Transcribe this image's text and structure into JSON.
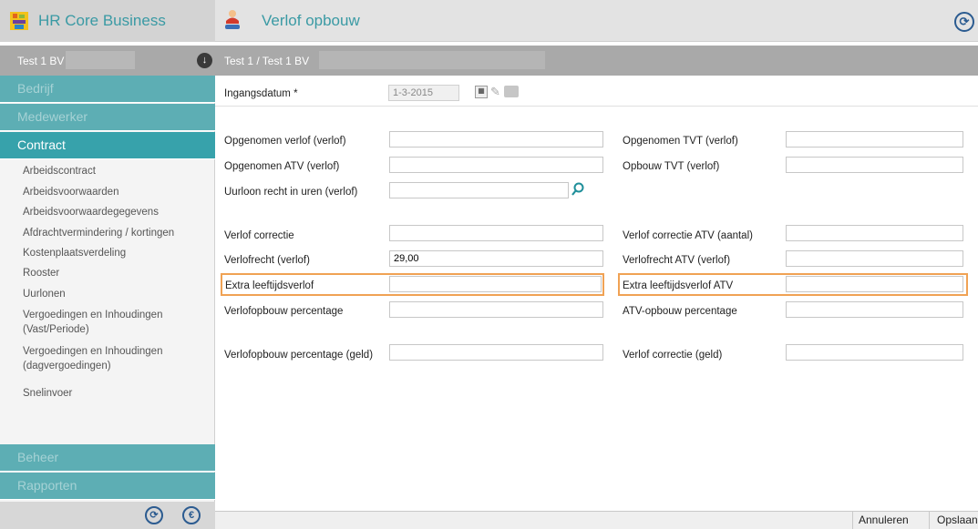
{
  "app": {
    "title": "HR Core Business",
    "logo_icon": "app-logo-icon"
  },
  "page": {
    "title": "Verlof opbouw"
  },
  "company": {
    "name": "Test 1 BV"
  },
  "breadcrumb": "Test 1 / Test 1 BV",
  "sidebar": {
    "sections": {
      "bedrijf": "Bedrijf",
      "medewerker": "Medewerker",
      "contract": "Contract",
      "beheer": "Beheer",
      "rapporten": "Rapporten"
    },
    "contract_items": [
      "Arbeidscontract",
      "Arbeidsvoorwaarden",
      "Arbeidsvoorwaardegegevens",
      "Afdrachtvermindering / kortingen",
      "Kostenplaatsverdeling",
      "Rooster",
      "Uurlonen",
      "Vergoedingen en Inhoudingen (Vast/Periode)",
      "Vergoedingen en Inhoudingen (dagvergoedingen)",
      "Snelinvoer"
    ]
  },
  "form": {
    "ingangsdatum": {
      "label": "Ingangsdatum *",
      "value": "1-3-2015"
    },
    "left": {
      "opgenomen_verlof": {
        "label": "Opgenomen verlof (verlof)",
        "value": ""
      },
      "opgenomen_atv": {
        "label": "Opgenomen ATV (verlof)",
        "value": ""
      },
      "uurloon_recht": {
        "label": "Uurloon recht in uren (verlof)",
        "value": ""
      },
      "verlof_correctie": {
        "label": "Verlof correctie",
        "value": ""
      },
      "verlofrecht": {
        "label": "Verlofrecht (verlof)",
        "value": "29,00"
      },
      "extra_leeftijdsverlof": {
        "label": "Extra leeftijdsverlof",
        "value": ""
      },
      "verlofopbouw_percentage": {
        "label": "Verlofopbouw percentage",
        "value": ""
      },
      "verlofopbouw_percentage_geld": {
        "label": "Verlofopbouw percentage (geld)",
        "value": ""
      }
    },
    "right": {
      "opgenomen_tvt": {
        "label": "Opgenomen TVT (verlof)",
        "value": ""
      },
      "opbouw_tvt": {
        "label": "Opbouw TVT (verlof)",
        "value": ""
      },
      "verlof_correctie_atv": {
        "label": "Verlof correctie ATV (aantal)",
        "value": ""
      },
      "verlofrecht_atv": {
        "label": "Verlofrecht ATV (verlof)",
        "value": ""
      },
      "extra_leeftijdsverlof_atv": {
        "label": "Extra leeftijdsverlof ATV",
        "value": ""
      },
      "atv_opbouw_percentage": {
        "label": "ATV-opbouw percentage",
        "value": ""
      },
      "verlof_correctie_geld": {
        "label": "Verlof correctie (geld)",
        "value": ""
      }
    }
  },
  "footer": {
    "cancel": "Annuleren",
    "save": "Opslaan"
  },
  "colors": {
    "accent": "#37a2ab",
    "highlight": "#f0a254",
    "header_text": "#3a9aa4"
  }
}
